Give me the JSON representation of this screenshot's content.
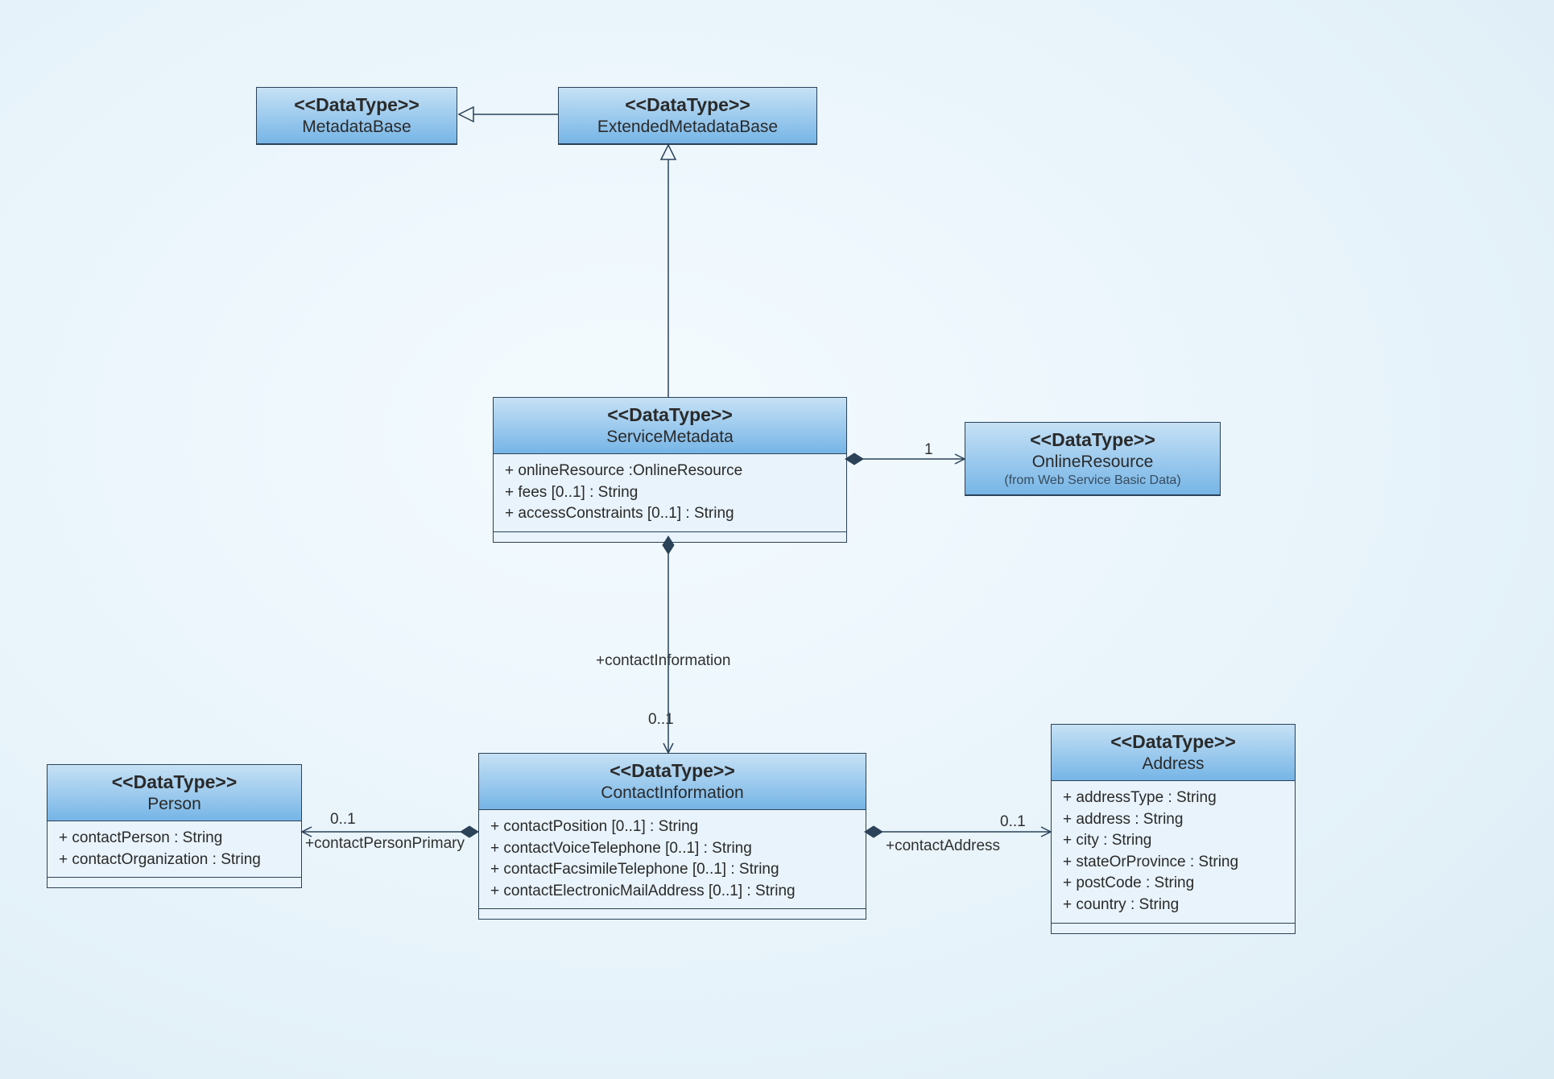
{
  "classes": {
    "metadataBase": {
      "stereotype": "<<DataType>>",
      "name": "MetadataBase"
    },
    "extendedMetadataBase": {
      "stereotype": "<<DataType>>",
      "name": "ExtendedMetadataBase"
    },
    "serviceMetadata": {
      "stereotype": "<<DataType>>",
      "name": "ServiceMetadata",
      "attrs": [
        "+ onlineResource :OnlineResource",
        "+ fees [0..1] : String",
        "+ accessConstraints [0..1] : String"
      ]
    },
    "onlineResource": {
      "stereotype": "<<DataType>>",
      "name": "OnlineResource",
      "subnote": "(from Web Service Basic Data)"
    },
    "contactInformation": {
      "stereotype": "<<DataType>>",
      "name": "ContactInformation",
      "attrs": [
        "+ contactPosition [0..1] : String",
        "+ contactVoiceTelephone [0..1] : String",
        "+ contactFacsimileTelephone [0..1] : String",
        "+ contactElectronicMailAddress [0..1] : String"
      ]
    },
    "person": {
      "stereotype": "<<DataType>>",
      "name": "Person",
      "attrs": [
        "+ contactPerson : String",
        "+ contactOrganization : String"
      ]
    },
    "address": {
      "stereotype": "<<DataType>>",
      "name": "Address",
      "attrs": [
        "+ addressType : String",
        "+ address : String",
        "+ city : String",
        "+ stateOrProvince : String",
        "+ postCode : String",
        "+ country : String"
      ]
    }
  },
  "labels": {
    "contactInformationRole": "+contactInformation",
    "contactInformationMult": "0..1",
    "onlineResourceMult": "1",
    "personMult": "0..1",
    "contactPersonPrimary": "+contactPersonPrimary",
    "addressMult": "0..1",
    "contactAddress": "+contactAddress"
  }
}
